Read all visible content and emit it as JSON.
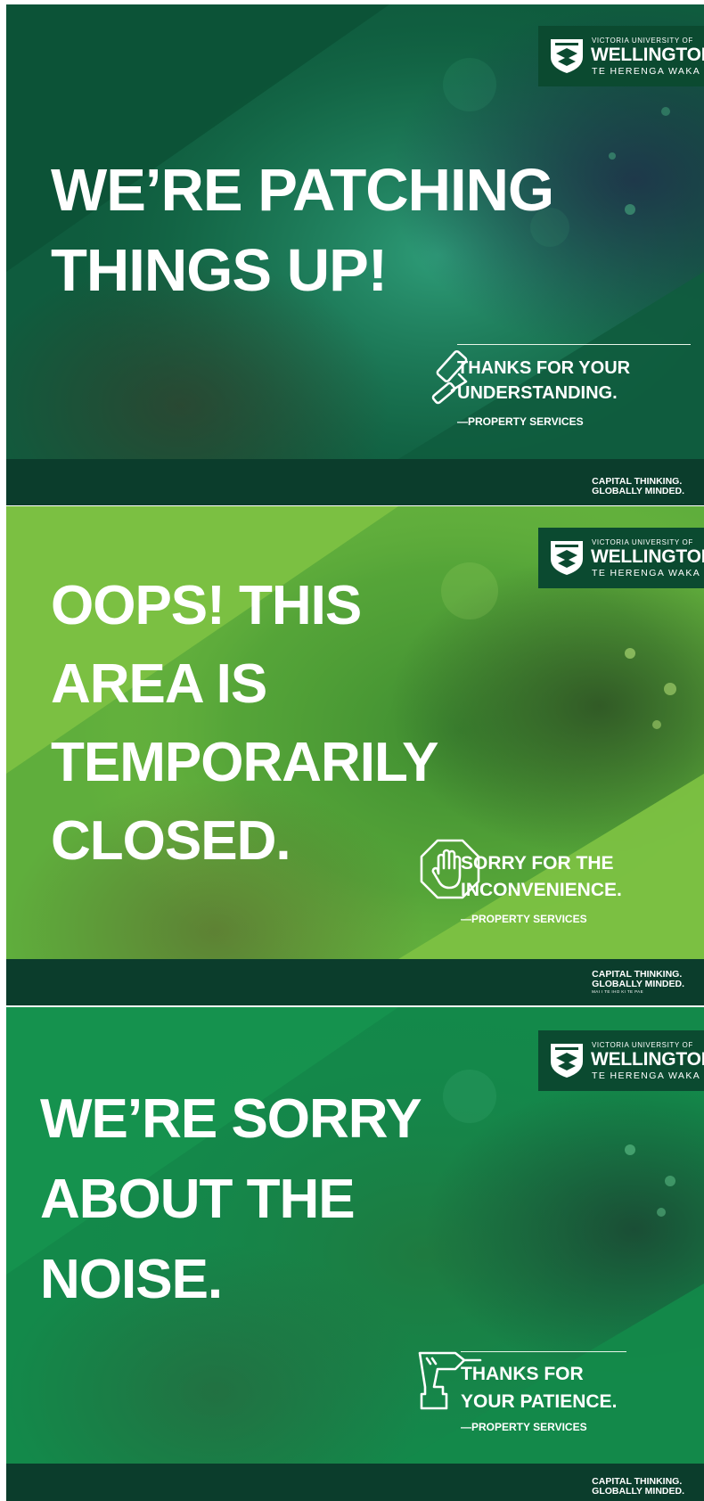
{
  "brand": {
    "university_small": "VICTORIA UNIVERSITY OF",
    "university_big": "WELLINGTON",
    "university_sub": "TE HERENGA WAKA",
    "tagline_line1": "CAPITAL THINKING.",
    "tagline_line2": "GLOBALLY MINDED.",
    "tagline_small": "MAI I TE IHO KI TE PAE",
    "colors": {
      "dark_green": "#0b4a30",
      "forest_green": "#0f5c3e",
      "lime_green": "#7cc142",
      "mid_green": "#13894a",
      "footer_green": "#0b3d2c",
      "text_white": "#ffffff"
    }
  },
  "panels": [
    {
      "headline": [
        "WE’RE PATCHING",
        "THINGS UP!"
      ],
      "icon": "paint-roller-icon",
      "message": [
        "THANKS FOR YOUR",
        "UNDERSTANDING."
      ],
      "signature": "—PROPERTY SERVICES"
    },
    {
      "headline": [
        "OOPS! THIS",
        "AREA IS",
        "TEMPORARILY",
        "CLOSED."
      ],
      "icon": "stop-hand-icon",
      "message": [
        "SORRY FOR THE",
        "INCONVENIENCE."
      ],
      "signature": "—PROPERTY SERVICES"
    },
    {
      "headline": [
        "WE’RE SORRY",
        "ABOUT THE",
        "NOISE."
      ],
      "icon": "power-drill-icon",
      "message": [
        "THANKS FOR",
        "YOUR PATIENCE."
      ],
      "signature": "—PROPERTY SERVICES"
    }
  ]
}
